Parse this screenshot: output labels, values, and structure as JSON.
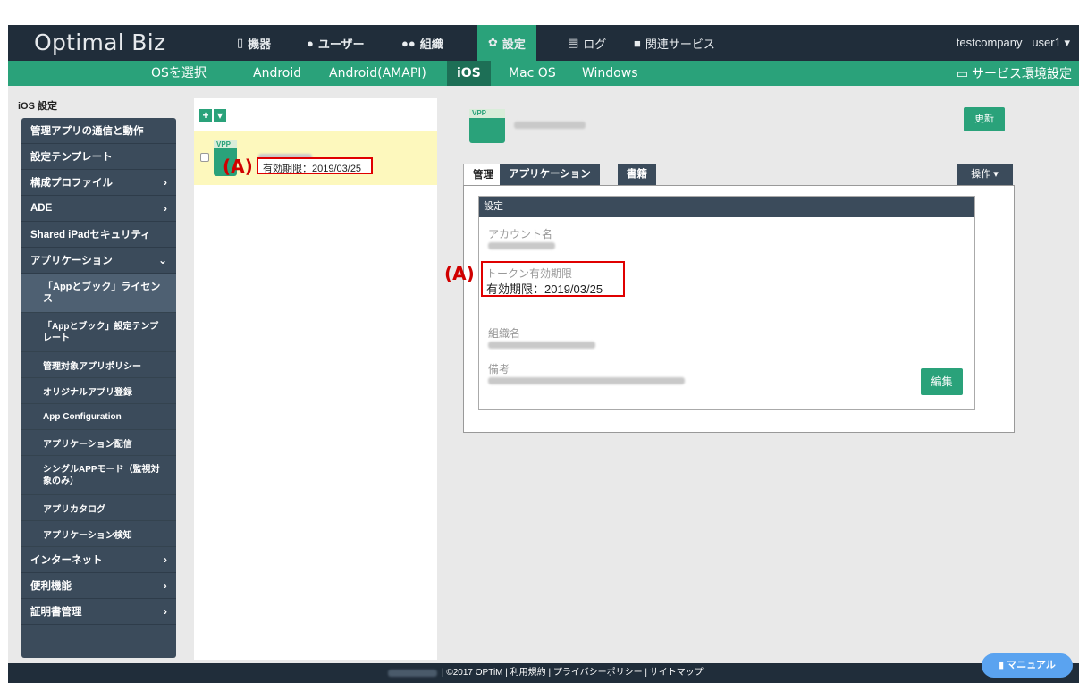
{
  "app": {
    "brand": "Optimal Biz"
  },
  "nav": {
    "devices": "機器",
    "users": "ユーザー",
    "org": "組織",
    "settings": "設定",
    "log": "ログ",
    "related": "関連サービス",
    "company": "testcompany",
    "user": "user1"
  },
  "subnav": {
    "select_os": "OSを選択",
    "tabs": [
      "Android",
      "Android(AMAPI)",
      "iOS",
      "Mac OS",
      "Windows"
    ],
    "service_settings": "サービス環境設定"
  },
  "sidebar": {
    "title": "iOS 設定",
    "items": [
      "管理アプリの通信と動作",
      "設定テンプレート",
      "構成プロファイル",
      "ADE",
      "Shared iPadセキュリティ",
      "アプリケーション"
    ],
    "subitems": [
      "「Appとブック」ライセンス",
      "「Appとブック」設定テンプレート",
      "管理対象アプリポリシー",
      "オリジナルアプリ登録",
      "App Configuration",
      "アプリケーション配信",
      "シングルAPPモード（監視対象のみ）",
      "アプリカタログ",
      "アプリケーション検知"
    ],
    "bottom_items": [
      "インターネット",
      "便利機能",
      "証明書管理"
    ]
  },
  "list": {
    "vpp_tag": "VPP",
    "expiry": "有効期限：2019/03/25",
    "annotation": "(A)"
  },
  "detail": {
    "vpp_tag": "VPP",
    "update": "更新",
    "tabs": [
      "管理",
      "アプリケーション",
      "書籍"
    ],
    "operation": "操作",
    "settings_header": "設定",
    "account_label": "アカウント名",
    "token_label": "トークン有効期限",
    "token_value": "有効期限：2019/03/25",
    "org_label": "組織名",
    "note_label": "備考",
    "edit": "編集",
    "annotation": "(A)"
  },
  "footer": {
    "text": "| ©2017 OPTiM | 利用規約 | プライバシーポリシー | サイトマップ"
  },
  "manual": "マニュアル",
  "colors": {
    "green": "#2aa27a",
    "dark": "#202d3a",
    "sidebar": "#3b4b5b",
    "highlight": "#fdf8bd",
    "annotation_red": "#e00000"
  }
}
